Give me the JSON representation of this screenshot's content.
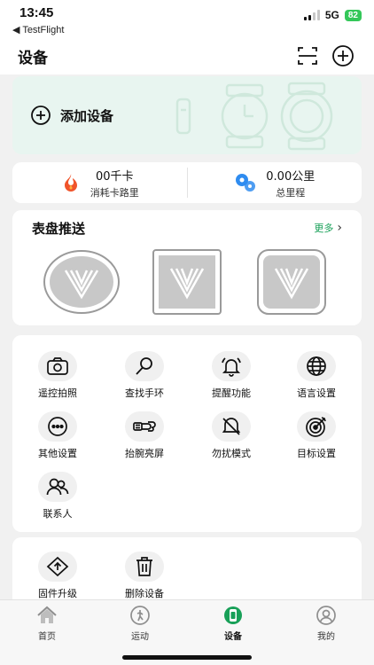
{
  "status": {
    "time": "13:45",
    "back": "◀ TestFlight",
    "network": "5G",
    "battery": "82"
  },
  "nav": {
    "title": "设备"
  },
  "add_device": {
    "label": "添加设备"
  },
  "stats": [
    {
      "value": "00千卡",
      "label": "消耗卡路里"
    },
    {
      "value": "0.00公里",
      "label": "总里程"
    }
  ],
  "dials": {
    "title": "表盘推送",
    "more": "更多"
  },
  "functions": [
    {
      "label": "遥控拍照",
      "icon": "camera-icon"
    },
    {
      "label": "查找手环",
      "icon": "magnifier-icon"
    },
    {
      "label": "提醒功能",
      "icon": "bell-icon"
    },
    {
      "label": "语言设置",
      "icon": "globe-icon"
    },
    {
      "label": "其他设置",
      "icon": "more-dots-icon"
    },
    {
      "label": "抬腕亮屏",
      "icon": "wrist-raise-icon"
    },
    {
      "label": "勿扰模式",
      "icon": "do-not-disturb-icon"
    },
    {
      "label": "目标设置",
      "icon": "target-icon"
    },
    {
      "label": "联系人",
      "icon": "contacts-icon"
    }
  ],
  "firmware": [
    {
      "label": "固件升级",
      "icon": "upgrade-icon"
    },
    {
      "label": "删除设备",
      "icon": "trash-icon"
    }
  ],
  "tabs": [
    {
      "label": "首页",
      "icon": "home-icon"
    },
    {
      "label": "运动",
      "icon": "run-icon"
    },
    {
      "label": "设备",
      "icon": "watch-icon"
    },
    {
      "label": "我的",
      "icon": "profile-icon"
    }
  ],
  "colors": {
    "accent": "#18a058",
    "add_card_bg": "#e8f5f0",
    "battery": "#34c759"
  }
}
